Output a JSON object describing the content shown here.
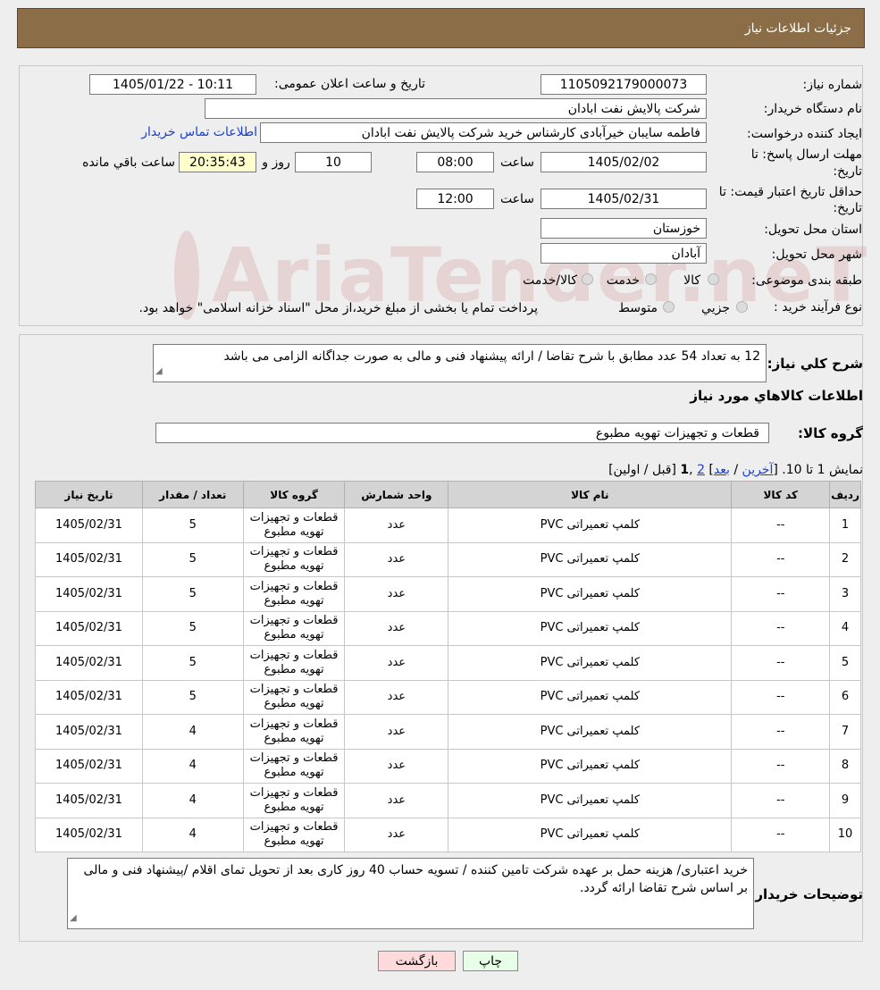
{
  "header": {
    "title": "جزئیات اطلاعات نیاز"
  },
  "need_number": {
    "label": "شماره نیاز:",
    "value": "1105092179000073"
  },
  "announce": {
    "label": "تاریخ و ساعت اعلان عمومی:",
    "value": "1405/01/22 - 10:11"
  },
  "buyer_org": {
    "label": "نام دستگاه خریدار:",
    "value": "شرکت پالایش نفت ابادان"
  },
  "requester": {
    "label": "ایجاد کننده درخواست:",
    "value": "فاطمه سایبان خیرآبادی کارشناس خرید شرکت پالایش نفت ابادان",
    "contact_link": "اطلاعات تماس خریدار"
  },
  "reply_deadline": {
    "label_line1": "مهلت ارسال پاسخ: تا",
    "label_line2": "تاریخ:",
    "date": "1405/02/02",
    "time_label": "ساعت",
    "time": "08:00",
    "days": "10",
    "days_label": "روز و",
    "remaining": "20:35:43",
    "remaining_label": "ساعت باقي مانده"
  },
  "price_validity": {
    "label_line1": "حداقل تاریخ اعتبار قیمت: تا",
    "label_line2": "تاریخ:",
    "date": "1405/02/31",
    "time_label": "ساعت",
    "time": "12:00"
  },
  "province": {
    "label": "استان محل تحویل:",
    "value": "خوزستان"
  },
  "city": {
    "label": "شهر محل تحویل:",
    "value": "آبادان"
  },
  "category": {
    "label": "طبقه بندی موضوعی:",
    "options": [
      "کالا",
      "خدمت",
      "کالا/خدمت"
    ]
  },
  "process": {
    "label": "نوع فرآیند خرید :",
    "options": [
      "جزیي",
      "متوسط"
    ],
    "note": "پرداخت تمام یا بخشی از مبلغ خرید،از محل \"اسناد خزانه اسلامی\" خواهد بود."
  },
  "description": {
    "label": "شرح کلي نياز:",
    "value": "12 به تعداد 54 عدد مطابق با شرح تقاضا / ارائه پیشنهاد فنی و مالی به صورت جداگانه الزامی می باشد"
  },
  "goods_section_title": "اطلاعات کالاهاي مورد نياز",
  "goods_group": {
    "label": "گروه کالا:",
    "value": "قطعات و تجهیزات تهویه مطبوع"
  },
  "paging": {
    "prefix": "نمایش 1 تا 10.",
    "last": "آخرین",
    "next": "بعد",
    "page2": "2",
    "page1": "1",
    "prev_first": "[قبل / اولین]"
  },
  "table": {
    "headers": [
      "رديف",
      "کد کالا",
      "نام کالا",
      "واحد شمارش",
      "گروه کالا",
      "تعداد / مقدار",
      "تاریخ نیاز"
    ],
    "rows": [
      [
        "1",
        "--",
        "کلمپ تعمیراتی PVC",
        "عدد",
        "قطعات و تجهیزات تهویه مطبوع",
        "5",
        "1405/02/31"
      ],
      [
        "2",
        "--",
        "کلمپ تعمیراتی PVC",
        "عدد",
        "قطعات و تجهیزات تهویه مطبوع",
        "5",
        "1405/02/31"
      ],
      [
        "3",
        "--",
        "کلمپ تعمیراتی PVC",
        "عدد",
        "قطعات و تجهیزات تهویه مطبوع",
        "5",
        "1405/02/31"
      ],
      [
        "4",
        "--",
        "کلمپ تعمیراتی PVC",
        "عدد",
        "قطعات و تجهیزات تهویه مطبوع",
        "5",
        "1405/02/31"
      ],
      [
        "5",
        "--",
        "کلمپ تعمیراتی PVC",
        "عدد",
        "قطعات و تجهیزات تهویه مطبوع",
        "5",
        "1405/02/31"
      ],
      [
        "6",
        "--",
        "کلمپ تعمیراتی PVC",
        "عدد",
        "قطعات و تجهیزات تهویه مطبوع",
        "5",
        "1405/02/31"
      ],
      [
        "7",
        "--",
        "کلمپ تعمیراتی PVC",
        "عدد",
        "قطعات و تجهیزات تهویه مطبوع",
        "4",
        "1405/02/31"
      ],
      [
        "8",
        "--",
        "کلمپ تعمیراتی PVC",
        "عدد",
        "قطعات و تجهیزات تهویه مطبوع",
        "4",
        "1405/02/31"
      ],
      [
        "9",
        "--",
        "کلمپ تعمیراتی PVC",
        "عدد",
        "قطعات و تجهیزات تهویه مطبوع",
        "4",
        "1405/02/31"
      ],
      [
        "10",
        "--",
        "کلمپ تعمیراتی PVC",
        "عدد",
        "قطعات و تجهیزات تهویه مطبوع",
        "4",
        "1405/02/31"
      ]
    ]
  },
  "buyer_notes": {
    "label": "توضیحات خریدار:",
    "value": "خرید اعتباری/ هزینه حمل بر عهده شرکت تامین کننده / تسویه حساب 40 روز کاری بعد از تحویل تمای اقلام /پیشنهاد فنی و مالی بر اساس شرح تقاضا ارائه گردد."
  },
  "buttons": {
    "print": "چاپ",
    "back": "بازگشت"
  },
  "watermark": {
    "text": "AriaTender.neT"
  },
  "colors": {
    "header_bg": "#8b6e47",
    "link": "#1a3fd1",
    "back_button": "#ffdada",
    "print_button": "#e6ffe6"
  }
}
